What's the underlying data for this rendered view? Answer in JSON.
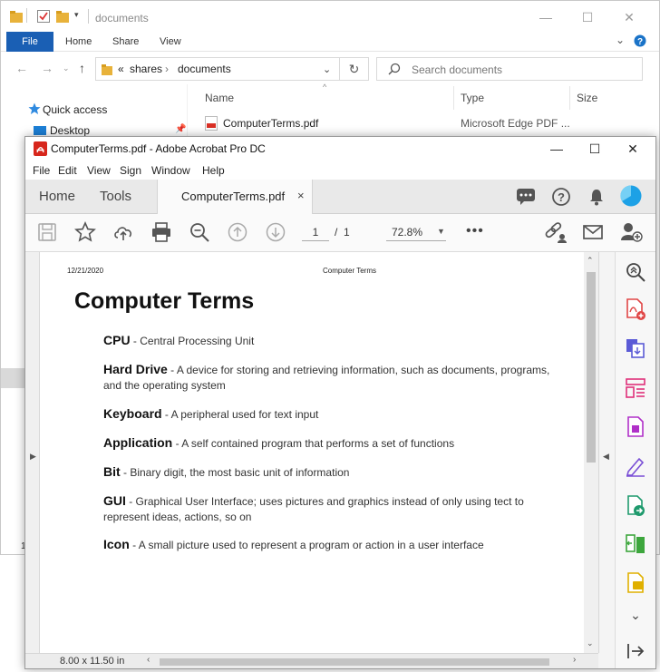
{
  "explorer": {
    "title": "documents",
    "ribbon_tabs": [
      "File",
      "Home",
      "Share",
      "View"
    ],
    "address": {
      "chevrons": "«",
      "crumbs": [
        "shares",
        "documents"
      ]
    },
    "search_placeholder": "Search documents",
    "nav_items": [
      "Quick access",
      "Desktop"
    ],
    "columns": [
      "Name",
      "Type",
      "Size"
    ],
    "rows": [
      {
        "name": "ComputerTerms.pdf",
        "type": "Microsoft Edge PDF ..."
      }
    ],
    "left_marker": "1"
  },
  "acrobat": {
    "title": "ComputerTerms.pdf - Adobe Acrobat Pro DC",
    "menu": [
      "File",
      "Edit",
      "View",
      "Sign",
      "Window",
      "Help"
    ],
    "tabs": {
      "home": "Home",
      "tools": "Tools",
      "document": "ComputerTerms.pdf",
      "close": "×"
    },
    "page": {
      "current": "1",
      "separator": "/",
      "total": "1"
    },
    "zoom": "72.8%",
    "page_size": "8.00 x 11.50 in",
    "accent_color": "#1da1e6",
    "right_tools": [
      "zoom-tool",
      "create-pdf",
      "combine-files",
      "organize-pages",
      "export-pdf",
      "fill-sign",
      "send-for-review",
      "compress-pdf",
      "comment",
      "expand-more",
      "collapse-panel"
    ]
  },
  "document": {
    "header_date": "12/21/2020",
    "header_title": "Computer Terms",
    "title": "Computer Terms",
    "terms": [
      {
        "term": "CPU",
        "definition": " - Central Processing Unit"
      },
      {
        "term": "Hard Drive",
        "definition": " - A device for storing and retrieving information, such as documents, programs, and the operating system"
      },
      {
        "term": "Keyboard",
        "definition": " - A peripheral used for text input"
      },
      {
        "term": "Application",
        "definition": " - A self contained program that performs a set of functions"
      },
      {
        "term": "Bit",
        "definition": " - Binary digit, the most basic unit of information"
      },
      {
        "term": "GUI",
        "definition": " - Graphical User Interface; uses pictures and graphics instead of only using tect to represent ideas, actions, so on"
      },
      {
        "term": "Icon",
        "definition": " - A small picture used to represent a program or action in a user interface"
      }
    ]
  }
}
